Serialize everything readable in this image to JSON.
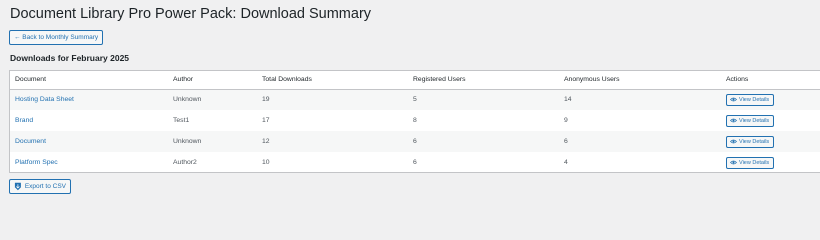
{
  "page": {
    "title": "Document Library Pro Power Pack: Download Summary",
    "back_button": "← Back to Monthly Summary",
    "section_title": "Downloads for February 2025",
    "export_button": "Export to CSV"
  },
  "table": {
    "headers": [
      "Document",
      "Author",
      "Total Downloads",
      "Registered Users",
      "Anonymous Users",
      "Actions"
    ],
    "rows": [
      {
        "document": "Hosting Data Sheet",
        "author": "Unknown",
        "total": "19",
        "registered": "5",
        "anonymous": "14",
        "action": "View Details"
      },
      {
        "document": "Brand",
        "author": "Test1",
        "total": "17",
        "registered": "8",
        "anonymous": "9",
        "action": "View Details"
      },
      {
        "document": "Document",
        "author": "Unknown",
        "total": "12",
        "registered": "6",
        "anonymous": "6",
        "action": "View Details"
      },
      {
        "document": "Platform Spec",
        "author": "Author2",
        "total": "10",
        "registered": "6",
        "anonymous": "4",
        "action": "View Details"
      }
    ]
  },
  "colors": {
    "background": "#f0f0f1",
    "link": "#2271b1",
    "text": "#1d2327",
    "border": "#c3c4c7"
  },
  "icons": {
    "view": "eye-icon",
    "export": "download-icon"
  }
}
